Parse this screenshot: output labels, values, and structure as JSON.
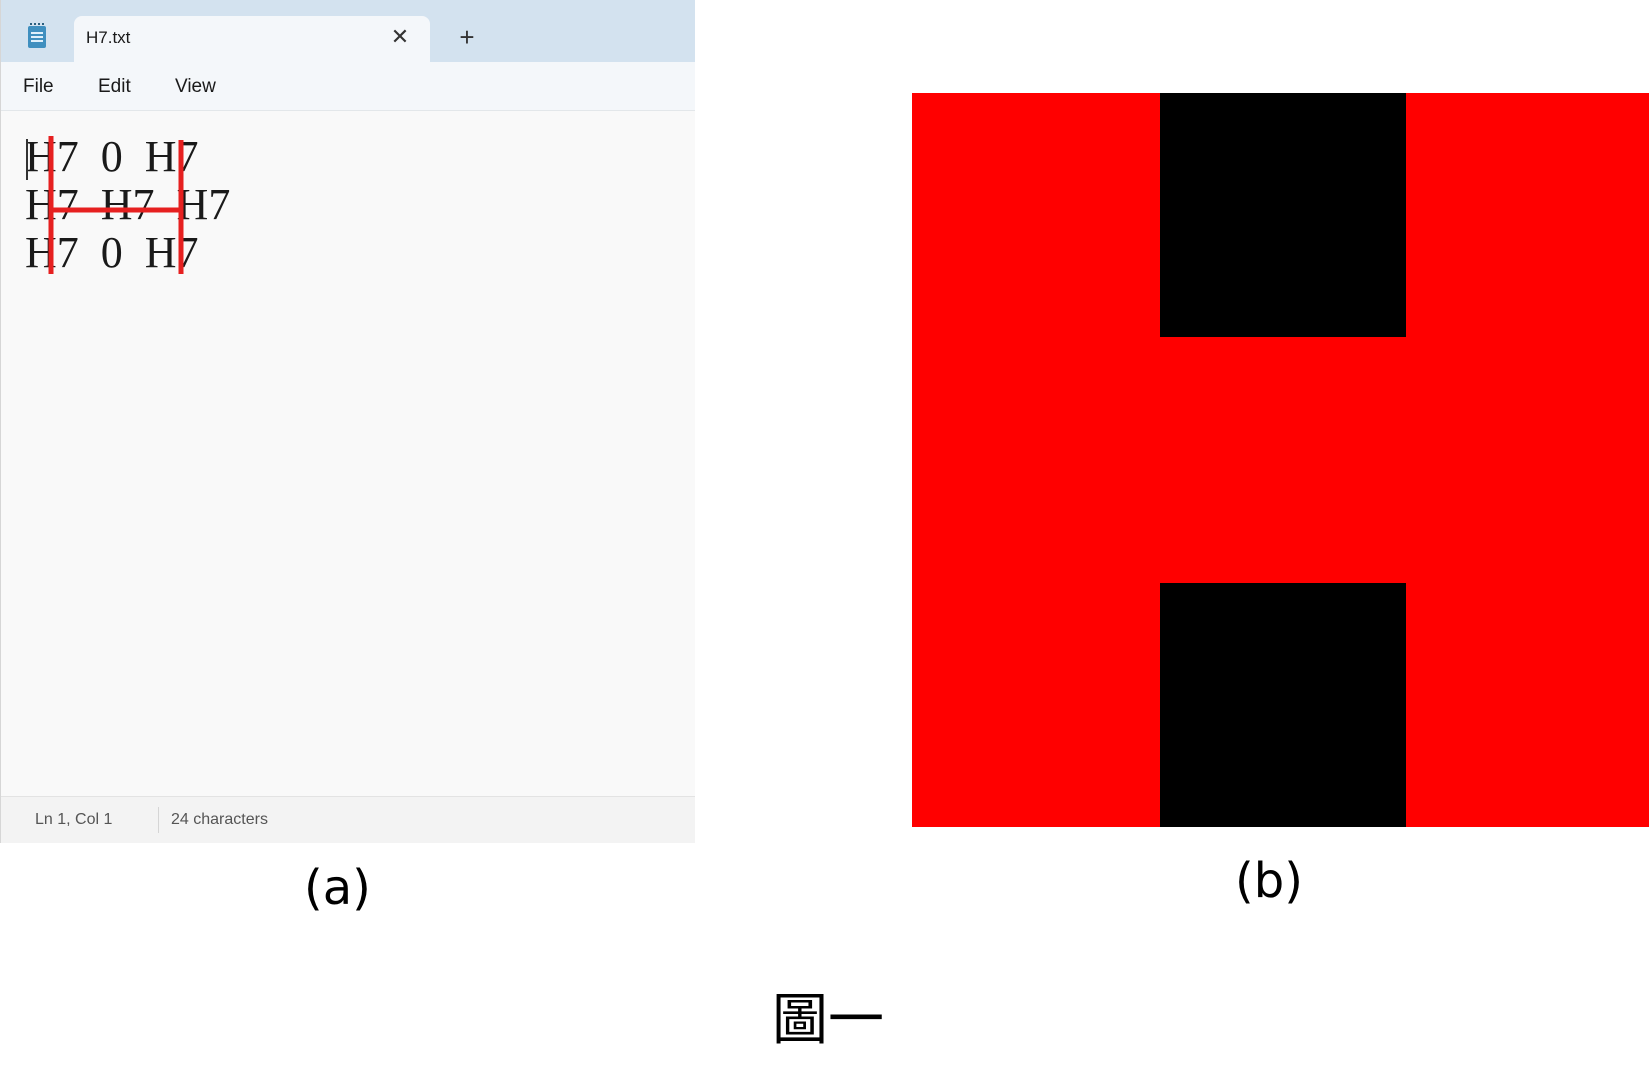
{
  "notepad": {
    "tab_title": "H7.txt",
    "tab_close_glyph": "✕",
    "new_tab_glyph": "+",
    "menu": {
      "file": "File",
      "edit": "Edit",
      "view": "View"
    },
    "text_lines": [
      "H7  0  H7",
      "H7  H7  H7",
      "H7  0  H7"
    ],
    "status": {
      "position": "Ln 1, Col 1",
      "characters": "24 characters"
    },
    "overlay_color": "#e62020"
  },
  "figure_b": {
    "colors": {
      "foreground": "#ff0000",
      "background": "#000000"
    }
  },
  "captions": {
    "a": "(a)",
    "b": "(b)",
    "figure_title": "圖一"
  }
}
